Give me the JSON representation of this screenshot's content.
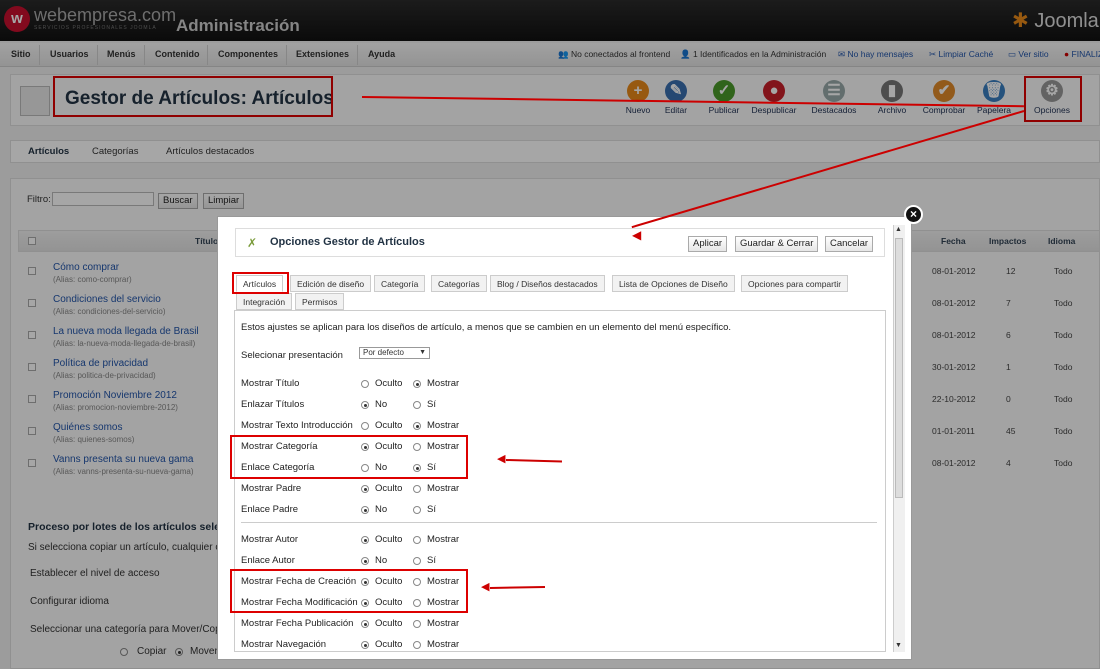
{
  "header": {
    "logo": "webempresa.com",
    "logo_sub": "SERVICIOS PROFESIONALES JOOMLA",
    "admin_title": "Administración",
    "joomla": "Joomla"
  },
  "menu": {
    "items": [
      "Sitio",
      "Usuarios",
      "Menús",
      "Contenido",
      "Componentes",
      "Extensiones",
      "Ayuda"
    ]
  },
  "status": {
    "frontend": "No conectados al frontend",
    "admin": "1 Identificados en la Administración",
    "messages": "No hay mensajes",
    "cache": "Limpiar Caché",
    "site": "Ver sitio",
    "logout": "FINALIZAR"
  },
  "page_title": "Gestor de Artículos: Artículos",
  "toolbar": [
    {
      "label": "Nuevo",
      "color": "#e8891a",
      "glyph": "+"
    },
    {
      "label": "Editar",
      "color": "#3a6fb0",
      "glyph": "✎"
    },
    {
      "label": "Publicar",
      "color": "#4a9a2a",
      "glyph": "✓"
    },
    {
      "label": "Despublicar",
      "color": "#c8202a",
      "glyph": "●"
    },
    {
      "label": "Destacados",
      "color": "#9aa",
      "glyph": "☰"
    },
    {
      "label": "Archivo",
      "color": "#777",
      "glyph": "▮"
    },
    {
      "label": "Comprobar",
      "color": "#e08a2a",
      "glyph": "✔"
    },
    {
      "label": "Papelera",
      "color": "#3a7fc0",
      "glyph": "🗑"
    },
    {
      "label": "Opciones",
      "color": "#999",
      "glyph": "⚙"
    }
  ],
  "subtabs": [
    "Artículos",
    "Categorías",
    "Artículos destacados"
  ],
  "filter": {
    "label": "Filtro:",
    "search": "Buscar",
    "clear": "Limpiar"
  },
  "table": {
    "headers": {
      "title": "Título",
      "date": "Fecha",
      "hits": "Impactos",
      "lang": "Idioma"
    },
    "rows": [
      {
        "title": "Cómo comprar",
        "alias": "(Alias: como-comprar)",
        "date": "08-01-2012",
        "hits": "12",
        "lang": "Todo"
      },
      {
        "title": "Condiciones del servicio",
        "alias": "(Alias: condiciones-del-servicio)",
        "date": "08-01-2012",
        "hits": "7",
        "lang": "Todo"
      },
      {
        "title": "La nueva moda llegada de Brasil",
        "alias": "(Alias: la-nueva-moda-llegada-de-brasil)",
        "date": "08-01-2012",
        "hits": "6",
        "lang": "Todo"
      },
      {
        "title": "Política de privacidad",
        "alias": "(Alias: politica-de-privacidad)",
        "date": "30-01-2012",
        "hits": "1",
        "lang": "Todo"
      },
      {
        "title": "Promoción Noviembre 2012",
        "alias": "(Alias: promocion-noviembre-2012)",
        "date": "22-10-2012",
        "hits": "0",
        "lang": "Todo"
      },
      {
        "title": "Quiénes somos",
        "alias": "(Alias: quienes-somos)",
        "date": "01-01-2011",
        "hits": "45",
        "lang": "Todo"
      },
      {
        "title": "Vanns presenta su nueva gama",
        "alias": "(Alias: vanns-presenta-su-nueva-gama)",
        "date": "08-01-2012",
        "hits": "4",
        "lang": "Todo"
      }
    ]
  },
  "batch": {
    "title": "Proceso por lotes de los artículos seleccionados",
    "desc": "Si selecciona copiar un artículo, cualquier otra",
    "level": "Establecer el nivel de acceso",
    "lang": "Configurar idioma",
    "cat": "Seleccionar una categoría para Mover/Copiar",
    "copy": "Copiar",
    "move": "Mover"
  },
  "modal": {
    "title": "Opciones Gestor de Artículos",
    "apply": "Aplicar",
    "save_close": "Guardar & Cerrar",
    "cancel": "Cancelar",
    "tabs": [
      "Artículos",
      "Edición de diseño",
      "Categoría",
      "Categorías",
      "Blog / Diseños destacados",
      "Lista de Opciones de Diseño",
      "Opciones para compartir",
      "Integración",
      "Permisos"
    ],
    "desc": "Estos ajustes se aplican para los diseños de artículo, a menos que se cambien en un elemento del menú específico.",
    "presentation_label": "Selecionar presentación",
    "presentation_value": "Por defecto",
    "options": [
      {
        "label": "Mostrar Título",
        "a": "Oculto",
        "b": "Mostrar",
        "sel": "b"
      },
      {
        "label": "Enlazar Títulos",
        "a": "No",
        "b": "Sí",
        "sel": "a"
      },
      {
        "label": "Mostrar Texto Introducción",
        "a": "Oculto",
        "b": "Mostrar",
        "sel": "b"
      },
      {
        "label": "Mostrar Categoría",
        "a": "Oculto",
        "b": "Mostrar",
        "sel": "a"
      },
      {
        "label": "Enlace Categoría",
        "a": "No",
        "b": "Sí",
        "sel": "b"
      },
      {
        "label": "Mostrar Padre",
        "a": "Oculto",
        "b": "Mostrar",
        "sel": "a"
      },
      {
        "label": "Enlace Padre",
        "a": "No",
        "b": "Sí",
        "sel": "a"
      },
      {
        "label": "Mostrar Autor",
        "a": "Oculto",
        "b": "Mostrar",
        "sel": "a"
      },
      {
        "label": "Enlace Autor",
        "a": "No",
        "b": "Sí",
        "sel": "a"
      },
      {
        "label": "Mostrar Fecha de Creación",
        "a": "Oculto",
        "b": "Mostrar",
        "sel": "a"
      },
      {
        "label": "Mostrar Fecha Modificación",
        "a": "Oculto",
        "b": "Mostrar",
        "sel": "a"
      },
      {
        "label": "Mostrar Fecha Publicación",
        "a": "Oculto",
        "b": "Mostrar",
        "sel": "a"
      },
      {
        "label": "Mostrar Navegación",
        "a": "Oculto",
        "b": "Mostrar",
        "sel": "a"
      }
    ]
  },
  "colors": {
    "highlight": "#dd0000",
    "link": "#2255aa"
  }
}
